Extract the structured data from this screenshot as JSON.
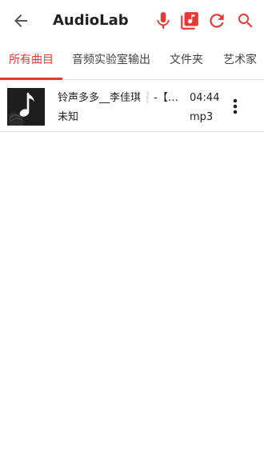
{
  "appbar": {
    "title": "AudioLab",
    "accent_color": "#e53935",
    "icons": [
      "arrow-back-icon",
      "microphone-icon",
      "music-library-icon",
      "refresh-icon",
      "search-icon"
    ]
  },
  "tabs": [
    {
      "label": "所有曲目",
      "selected": true
    },
    {
      "label": "音频实验室输出",
      "selected": false
    },
    {
      "label": "文件夹",
      "selected": false
    },
    {
      "label": "艺术家",
      "selected": false
    }
  ],
  "songs": [
    {
      "title": "铃声多多__李佳琪❕-【中国风】",
      "artist": "未知",
      "duration": "04:44",
      "format": "mp3"
    }
  ]
}
